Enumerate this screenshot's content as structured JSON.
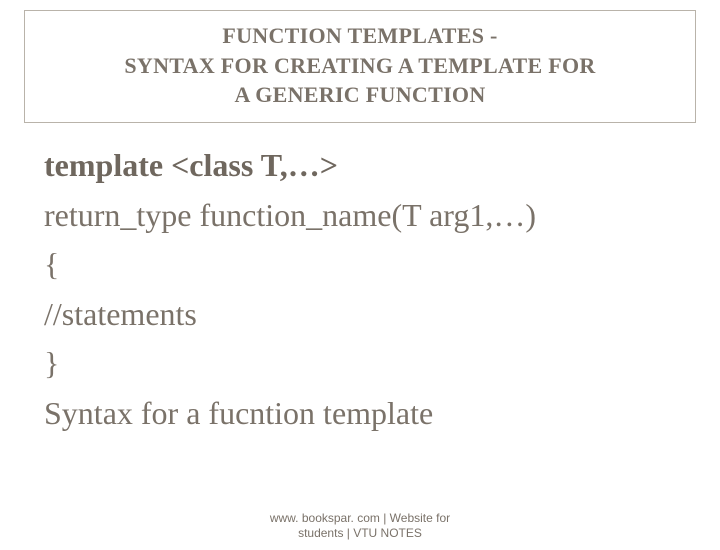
{
  "title": {
    "line1": "FUNCTION TEMPLATES -",
    "line2": "SYNTAX FOR CREATING A TEMPLATE FOR",
    "line3": "A GENERIC FUNCTION"
  },
  "body": {
    "l1": "template <class T,…>",
    "l2": "return_type function_name(T arg1,…)",
    "l3": "{",
    "l4": "//statements",
    "l5": "}",
    "l6": "Syntax for a fucntion template"
  },
  "footer": {
    "line1": "www. bookspar. com | Website for",
    "line2": "students | VTU NOTES"
  }
}
